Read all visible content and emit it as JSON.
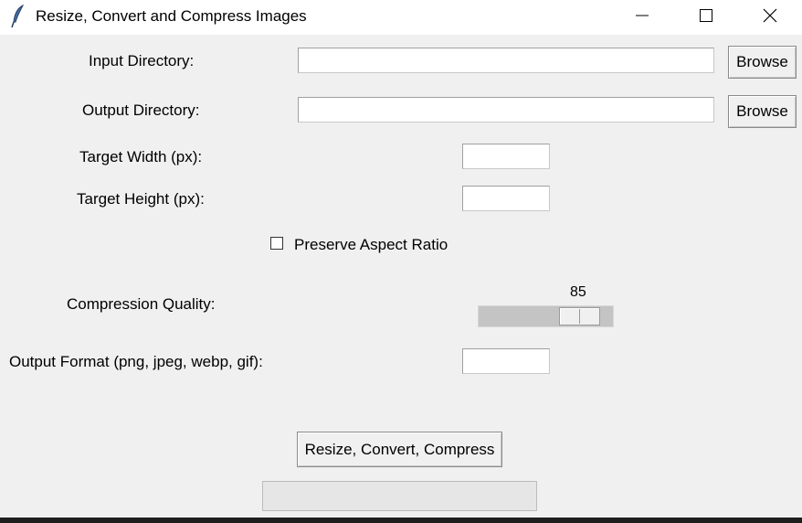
{
  "window": {
    "title": "Resize, Convert and Compress Images",
    "controls": [
      "minimize-icon",
      "maximize-icon",
      "close-icon"
    ]
  },
  "form": {
    "input_dir": {
      "label": "Input Directory:",
      "value": "",
      "browse_label": "Browse"
    },
    "output_dir": {
      "label": "Output Directory:",
      "value": "",
      "browse_label": "Browse"
    },
    "target_width": {
      "label": "Target Width (px):",
      "value": ""
    },
    "target_height": {
      "label": "Target Height (px):",
      "value": ""
    },
    "preserve_aspect": {
      "label": "Preserve Aspect Ratio",
      "checked": false
    },
    "quality": {
      "label": "Compression Quality:",
      "value": "85"
    },
    "output_format": {
      "label": "Output Format (png, jpeg, webp, gif):",
      "value": ""
    },
    "run_label": "Resize, Convert, Compress"
  },
  "progress": {
    "value": 0
  }
}
